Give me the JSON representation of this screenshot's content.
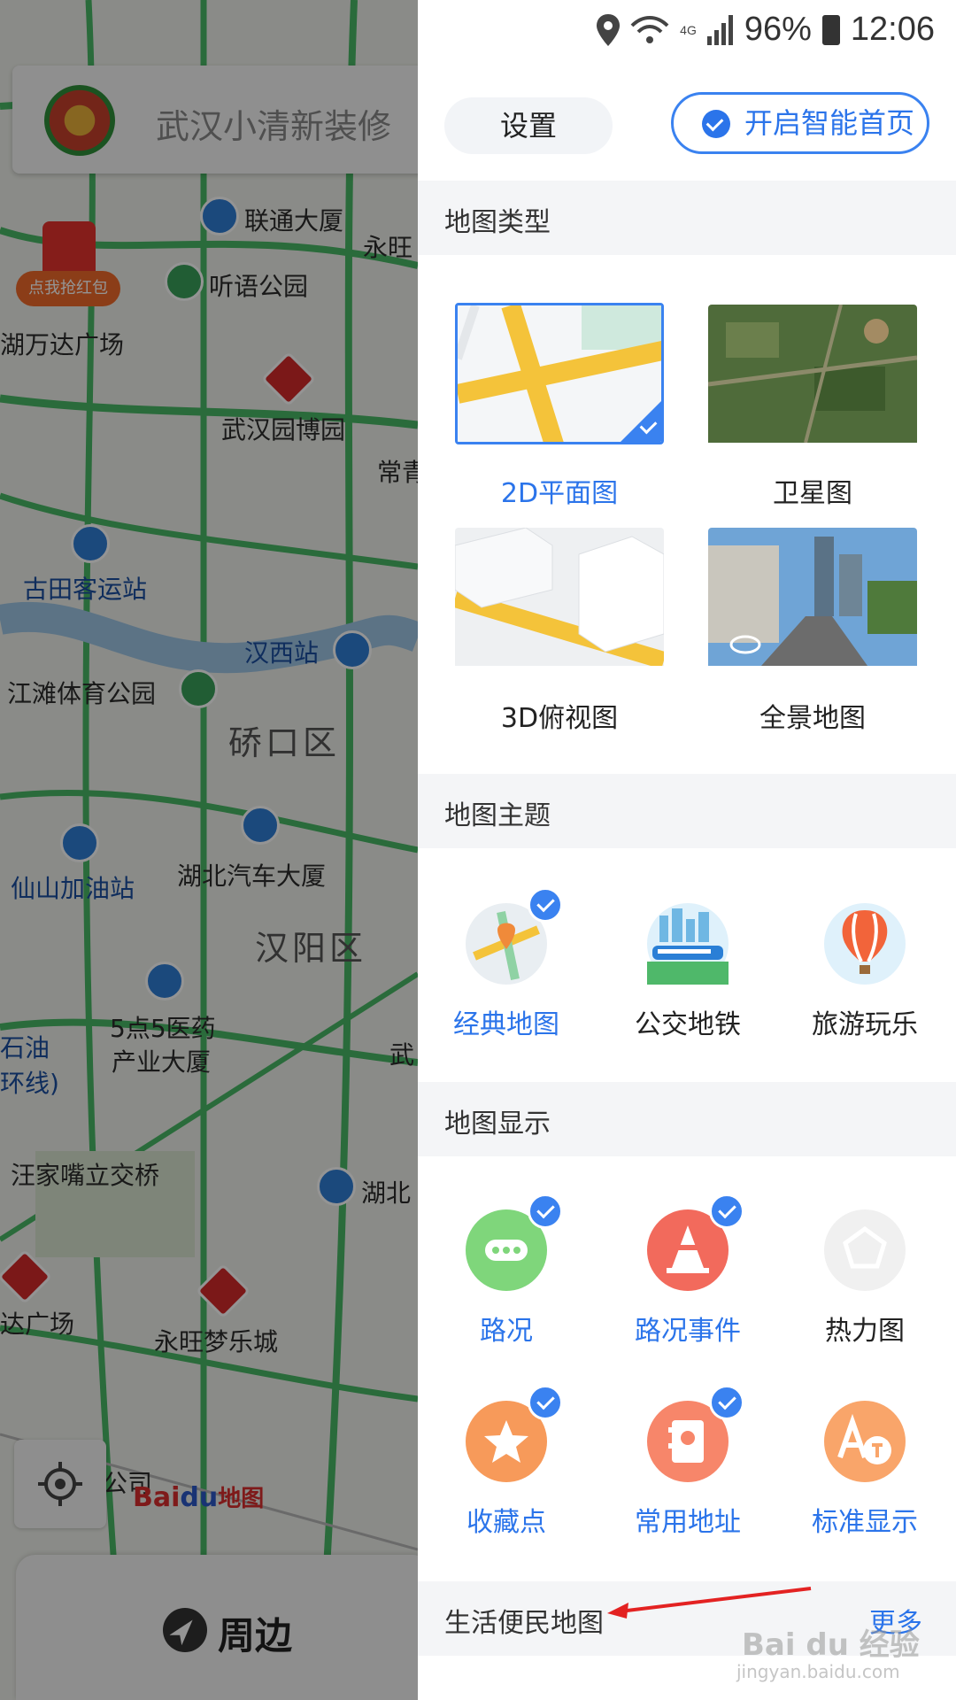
{
  "status_bar": {
    "battery": "96%",
    "time": "12:06",
    "network": "4G"
  },
  "map": {
    "search_text": "武汉小清新装修",
    "red_packet_label": "点我抢红包",
    "labels": {
      "liantong": "联通大厦",
      "yongwang_top": "永旺",
      "tingyu": "听语公园",
      "wanda": "湖万达广场",
      "yuanboyuan": "武汉园博园",
      "chang": "常青",
      "gutian": "古田客运站",
      "hanxi": "汉西站",
      "jiangtan": "江滩体育公园",
      "qiaokou": "硚口区",
      "xianshan": "仙山加油站",
      "hubei_auto": "湖北汽车大厦",
      "hanyang": "汉阳区",
      "building5": "5点5医药",
      "building5b": "产业大厦",
      "shiyou": "石油",
      "huanxian": "环线)",
      "wangjiazui": "汪家嘴立交桥",
      "hubei2": "湖北",
      "daguangchang": "达广场",
      "yongwang_city": "永旺梦乐城",
      "gongsi": "公司",
      "wu": "武"
    },
    "baidu_logo_bai": "Bai",
    "baidu_logo_du": "du",
    "baidu_logo_map": "地图",
    "nearby_label": "周边"
  },
  "panel": {
    "settings_label": "设置",
    "smart_home_label": "开启智能首页",
    "map_type": {
      "title": "地图类型",
      "items": [
        {
          "label": "2D平面图",
          "selected": true
        },
        {
          "label": "卫星图",
          "selected": false
        },
        {
          "label": "3D俯视图",
          "selected": false
        },
        {
          "label": "全景地图",
          "selected": false
        }
      ]
    },
    "map_theme": {
      "title": "地图主题",
      "items": [
        {
          "label": "经典地图",
          "icon": "classic-map-icon",
          "selected": true
        },
        {
          "label": "公交地铁",
          "icon": "transit-icon",
          "selected": false
        },
        {
          "label": "旅游玩乐",
          "icon": "hot-air-balloon-icon",
          "selected": false
        }
      ]
    },
    "map_display": {
      "title": "地图显示",
      "items": [
        {
          "label": "路况",
          "icon": "traffic-icon",
          "selected": true
        },
        {
          "label": "路况事件",
          "icon": "traffic-cone-icon",
          "selected": true
        },
        {
          "label": "热力图",
          "icon": "heatmap-icon",
          "selected": false
        },
        {
          "label": "收藏点",
          "icon": "star-icon",
          "selected": true
        },
        {
          "label": "常用地址",
          "icon": "address-book-icon",
          "selected": true
        },
        {
          "label": "标准显示",
          "icon": "label-icon",
          "selected": false
        }
      ]
    },
    "life_map": {
      "title": "生活便民地图",
      "more": "更多"
    }
  },
  "watermark": {
    "text": "Bai du 经验",
    "url": "jingyan.baidu.com"
  },
  "colors": {
    "accent": "#2b74ea",
    "traffic_green": "#2fa84f",
    "section_bg": "#f4f5f7"
  }
}
